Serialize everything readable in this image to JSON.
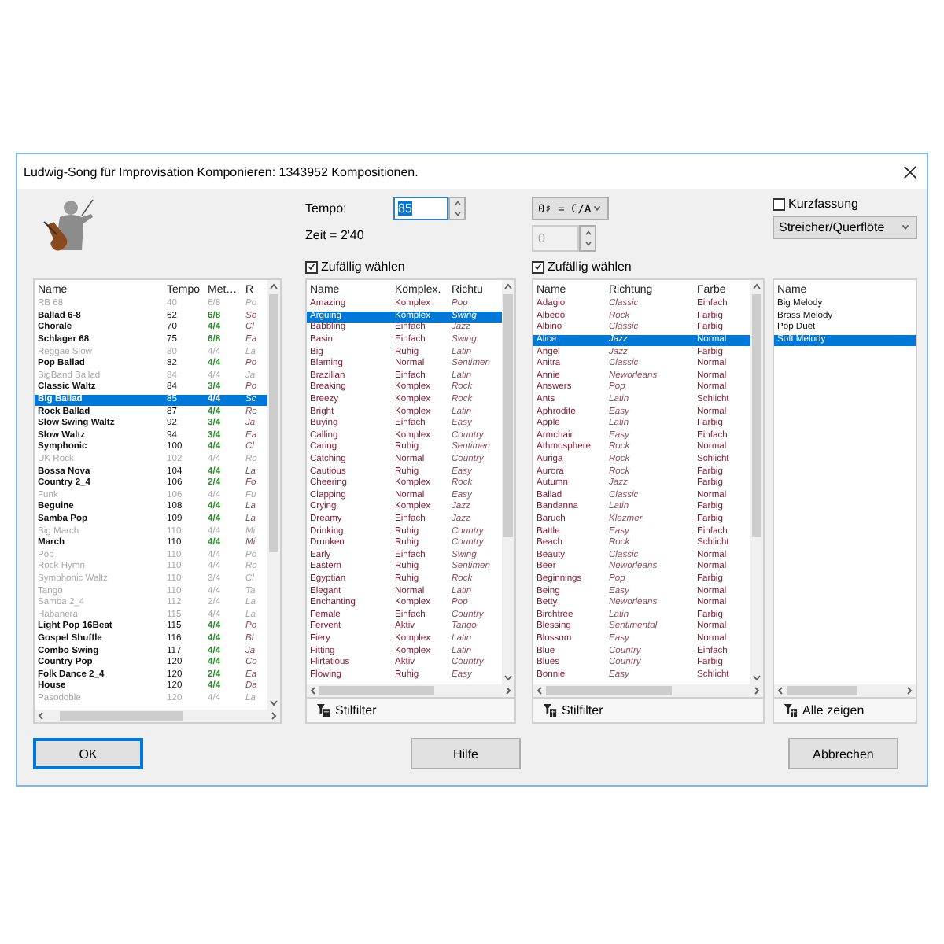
{
  "window": {
    "title": "Ludwig-Song für Improvisation Komponieren: 1343952 Kompositionen."
  },
  "tempo": {
    "label": "Tempo:",
    "value": "85",
    "selected": true,
    "duration": "Zeit = 2'40"
  },
  "key": {
    "value": "0♯ = C/A",
    "transpose": "0",
    "transpose_disabled": true
  },
  "summary": {
    "label": "Kurzfassung",
    "checked": false
  },
  "instrumentation": {
    "value": "Streicher/Querflöte"
  },
  "styles": {
    "columns": [
      {
        "label": "Name",
        "kind": "bold"
      },
      {
        "label": "Tempo",
        "kind": "plain"
      },
      {
        "label": "Met…",
        "kind": "meter"
      },
      {
        "label": "R",
        "kind": "italic"
      }
    ],
    "rows": [
      {
        "cells": [
          "RB 68",
          "40",
          "6/8",
          "Po"
        ],
        "greyed": true,
        "selected": false
      },
      {
        "cells": [
          "Ballad 6-8",
          "62",
          "6/8",
          "Se"
        ],
        "greyed": false,
        "selected": false
      },
      {
        "cells": [
          "Chorale",
          "70",
          "4/4",
          "Cl"
        ],
        "greyed": false,
        "selected": false
      },
      {
        "cells": [
          "Schlager 68",
          "75",
          "6/8",
          "Ea"
        ],
        "greyed": false,
        "selected": false
      },
      {
        "cells": [
          "Reggae Slow",
          "80",
          "4/4",
          "La"
        ],
        "greyed": true,
        "selected": false
      },
      {
        "cells": [
          "Pop Ballad",
          "82",
          "4/4",
          "Po"
        ],
        "greyed": false,
        "selected": false
      },
      {
        "cells": [
          "BigBand Ballad",
          "84",
          "4/4",
          "Ja"
        ],
        "greyed": true,
        "selected": false
      },
      {
        "cells": [
          "Classic Waltz",
          "84",
          "3/4",
          "Po"
        ],
        "greyed": false,
        "selected": false
      },
      {
        "cells": [
          "Big Ballad",
          "85",
          "4/4",
          "Sc"
        ],
        "greyed": false,
        "selected": true
      },
      {
        "cells": [
          "Rock Ballad",
          "87",
          "4/4",
          "Ro"
        ],
        "greyed": false,
        "selected": false
      },
      {
        "cells": [
          "Slow Swing Waltz",
          "92",
          "3/4",
          "Ja"
        ],
        "greyed": false,
        "selected": false
      },
      {
        "cells": [
          "Slow Waltz",
          "94",
          "3/4",
          "Ea"
        ],
        "greyed": false,
        "selected": false
      },
      {
        "cells": [
          "Symphonic",
          "100",
          "4/4",
          "Cl"
        ],
        "greyed": false,
        "selected": false
      },
      {
        "cells": [
          "UK Rock",
          "102",
          "4/4",
          "Ro"
        ],
        "greyed": true,
        "selected": false
      },
      {
        "cells": [
          "Bossa Nova",
          "104",
          "4/4",
          "La"
        ],
        "greyed": false,
        "selected": false
      },
      {
        "cells": [
          "Country 2_4",
          "106",
          "2/4",
          "Fo"
        ],
        "greyed": false,
        "selected": false
      },
      {
        "cells": [
          "Funk",
          "106",
          "4/4",
          "Fu"
        ],
        "greyed": true,
        "selected": false
      },
      {
        "cells": [
          "Beguine",
          "108",
          "4/4",
          "La"
        ],
        "greyed": false,
        "selected": false
      },
      {
        "cells": [
          "Samba Pop",
          "109",
          "4/4",
          "La"
        ],
        "greyed": false,
        "selected": false
      },
      {
        "cells": [
          "Big March",
          "110",
          "4/4",
          "Mi"
        ],
        "greyed": true,
        "selected": false
      },
      {
        "cells": [
          "March",
          "110",
          "4/4",
          "Mi"
        ],
        "greyed": false,
        "selected": false
      },
      {
        "cells": [
          "Pop",
          "110",
          "4/4",
          "Po"
        ],
        "greyed": true,
        "selected": false
      },
      {
        "cells": [
          "Rock Hymn",
          "110",
          "4/4",
          "Ro"
        ],
        "greyed": true,
        "selected": false
      },
      {
        "cells": [
          "Symphonic Waltz",
          "110",
          "3/4",
          "Cl"
        ],
        "greyed": true,
        "selected": false
      },
      {
        "cells": [
          "Tango",
          "110",
          "4/4",
          "Ta"
        ],
        "greyed": true,
        "selected": false
      },
      {
        "cells": [
          "Samba 2_4",
          "112",
          "2/4",
          "La"
        ],
        "greyed": true,
        "selected": false
      },
      {
        "cells": [
          "Habanera",
          "115",
          "4/4",
          "La"
        ],
        "greyed": true,
        "selected": false
      },
      {
        "cells": [
          "Light Pop 16Beat",
          "115",
          "4/4",
          "Po"
        ],
        "greyed": false,
        "selected": false
      },
      {
        "cells": [
          "Gospel Shuffle",
          "116",
          "4/4",
          "Bl"
        ],
        "greyed": false,
        "selected": false
      },
      {
        "cells": [
          "Combo Swing",
          "117",
          "4/4",
          "Ja"
        ],
        "greyed": false,
        "selected": false
      },
      {
        "cells": [
          "Country Pop",
          "120",
          "4/4",
          "Co"
        ],
        "greyed": false,
        "selected": false
      },
      {
        "cells": [
          "Folk Dance 2_4",
          "120",
          "2/4",
          "Ea"
        ],
        "greyed": false,
        "selected": false
      },
      {
        "cells": [
          "House",
          "120",
          "4/4",
          "Da"
        ],
        "greyed": false,
        "selected": false
      },
      {
        "cells": [
          "Pasodoble",
          "120",
          "4/4",
          "La"
        ],
        "greyed": true,
        "selected": false
      }
    ]
  },
  "melodies": {
    "random_pick": {
      "label": "Zufällig wählen",
      "checked": true
    },
    "filter_button": "Stilfilter",
    "columns": [
      {
        "label": "Name",
        "kind": "red"
      },
      {
        "label": "Komplex.",
        "kind": "red"
      },
      {
        "label": "Richtu",
        "kind": "italic"
      }
    ],
    "rows": [
      {
        "cells": [
          "Amazing",
          "Komplex",
          "Pop"
        ],
        "selected": false
      },
      {
        "cells": [
          "Arguing",
          "Komplex",
          "Swing"
        ],
        "selected": true
      },
      {
        "cells": [
          "Babbling",
          "Einfach",
          "Jazz"
        ],
        "selected": false
      },
      {
        "cells": [
          "Basin",
          "Einfach",
          "Swing"
        ],
        "selected": false
      },
      {
        "cells": [
          "Big",
          "Ruhig",
          "Latin"
        ],
        "selected": false
      },
      {
        "cells": [
          "Blaming",
          "Normal",
          "Sentimen"
        ],
        "selected": false
      },
      {
        "cells": [
          "Brazilian",
          "Einfach",
          "Latin"
        ],
        "selected": false
      },
      {
        "cells": [
          "Breaking",
          "Komplex",
          "Rock"
        ],
        "selected": false
      },
      {
        "cells": [
          "Breezy",
          "Komplex",
          "Rock"
        ],
        "selected": false
      },
      {
        "cells": [
          "Bright",
          "Komplex",
          "Latin"
        ],
        "selected": false
      },
      {
        "cells": [
          "Buying",
          "Einfach",
          "Easy"
        ],
        "selected": false
      },
      {
        "cells": [
          "Calling",
          "Komplex",
          "Country"
        ],
        "selected": false
      },
      {
        "cells": [
          "Caring",
          "Ruhig",
          "Sentimen"
        ],
        "selected": false
      },
      {
        "cells": [
          "Catching",
          "Normal",
          "Country"
        ],
        "selected": false
      },
      {
        "cells": [
          "Cautious",
          "Ruhig",
          "Easy"
        ],
        "selected": false
      },
      {
        "cells": [
          "Cheering",
          "Komplex",
          "Rock"
        ],
        "selected": false
      },
      {
        "cells": [
          "Clapping",
          "Normal",
          "Easy"
        ],
        "selected": false
      },
      {
        "cells": [
          "Crying",
          "Komplex",
          "Jazz"
        ],
        "selected": false
      },
      {
        "cells": [
          "Dreamy",
          "Einfach",
          "Jazz"
        ],
        "selected": false
      },
      {
        "cells": [
          "Drinking",
          "Ruhig",
          "Country"
        ],
        "selected": false
      },
      {
        "cells": [
          "Drunken",
          "Ruhig",
          "Country"
        ],
        "selected": false
      },
      {
        "cells": [
          "Early",
          "Einfach",
          "Swing"
        ],
        "selected": false
      },
      {
        "cells": [
          "Eastern",
          "Ruhig",
          "Sentimen"
        ],
        "selected": false
      },
      {
        "cells": [
          "Egyptian",
          "Ruhig",
          "Rock"
        ],
        "selected": false
      },
      {
        "cells": [
          "Elegant",
          "Normal",
          "Latin"
        ],
        "selected": false
      },
      {
        "cells": [
          "Enchanting",
          "Komplex",
          "Pop"
        ],
        "selected": false
      },
      {
        "cells": [
          "Female",
          "Einfach",
          "Country"
        ],
        "selected": false
      },
      {
        "cells": [
          "Fervent",
          "Aktiv",
          "Tango"
        ],
        "selected": false
      },
      {
        "cells": [
          "Fiery",
          "Komplex",
          "Latin"
        ],
        "selected": false
      },
      {
        "cells": [
          "Fitting",
          "Komplex",
          "Latin"
        ],
        "selected": false
      },
      {
        "cells": [
          "Flirtatious",
          "Aktiv",
          "Country"
        ],
        "selected": false
      },
      {
        "cells": [
          "Flowing",
          "Ruhig",
          "Easy"
        ],
        "selected": false
      }
    ]
  },
  "harmonies": {
    "random_pick": {
      "label": "Zufällig wählen",
      "checked": true
    },
    "filter_button": "Stilfilter",
    "columns": [
      {
        "label": "Name",
        "kind": "red"
      },
      {
        "label": "Richtung",
        "kind": "italic"
      },
      {
        "label": "Farbe",
        "kind": "red"
      }
    ],
    "rows": [
      {
        "cells": [
          "Adagio",
          "Classic",
          "Einfach"
        ],
        "selected": false
      },
      {
        "cells": [
          "Albedo",
          "Rock",
          "Farbig"
        ],
        "selected": false
      },
      {
        "cells": [
          "Albino",
          "Classic",
          "Farbig"
        ],
        "selected": false
      },
      {
        "cells": [
          "Alice",
          "Jazz",
          "Normal"
        ],
        "selected": true
      },
      {
        "cells": [
          "Angel",
          "Jazz",
          "Farbig"
        ],
        "selected": false
      },
      {
        "cells": [
          "Anitra",
          "Classic",
          "Normal"
        ],
        "selected": false
      },
      {
        "cells": [
          "Annie",
          "Neworleans",
          "Normal"
        ],
        "selected": false
      },
      {
        "cells": [
          "Answers",
          "Pop",
          "Normal"
        ],
        "selected": false
      },
      {
        "cells": [
          "Ants",
          "Latin",
          "Schlicht"
        ],
        "selected": false
      },
      {
        "cells": [
          "Aphrodite",
          "Easy",
          "Normal"
        ],
        "selected": false
      },
      {
        "cells": [
          "Apple",
          "Latin",
          "Farbig"
        ],
        "selected": false
      },
      {
        "cells": [
          "Armchair",
          "Easy",
          "Einfach"
        ],
        "selected": false
      },
      {
        "cells": [
          "Athmosphere",
          "Rock",
          "Normal"
        ],
        "selected": false
      },
      {
        "cells": [
          "Auriga",
          "Rock",
          "Schlicht"
        ],
        "selected": false
      },
      {
        "cells": [
          "Aurora",
          "Rock",
          "Farbig"
        ],
        "selected": false
      },
      {
        "cells": [
          "Autumn",
          "Jazz",
          "Farbig"
        ],
        "selected": false
      },
      {
        "cells": [
          "Ballad",
          "Classic",
          "Normal"
        ],
        "selected": false
      },
      {
        "cells": [
          "Bandanna",
          "Latin",
          "Farbig"
        ],
        "selected": false
      },
      {
        "cells": [
          "Baruch",
          "Klezmer",
          "Farbig"
        ],
        "selected": false
      },
      {
        "cells": [
          "Battle",
          "Easy",
          "Einfach"
        ],
        "selected": false
      },
      {
        "cells": [
          "Beach",
          "Rock",
          "Schlicht"
        ],
        "selected": false
      },
      {
        "cells": [
          "Beauty",
          "Classic",
          "Normal"
        ],
        "selected": false
      },
      {
        "cells": [
          "Beer",
          "Neworleans",
          "Normal"
        ],
        "selected": false
      },
      {
        "cells": [
          "Beginnings",
          "Pop",
          "Farbig"
        ],
        "selected": false
      },
      {
        "cells": [
          "Being",
          "Easy",
          "Normal"
        ],
        "selected": false
      },
      {
        "cells": [
          "Betty",
          "Neworleans",
          "Normal"
        ],
        "selected": false
      },
      {
        "cells": [
          "Birchtree",
          "Latin",
          "Farbig"
        ],
        "selected": false
      },
      {
        "cells": [
          "Blessing",
          "Sentimental",
          "Normal"
        ],
        "selected": false
      },
      {
        "cells": [
          "Blossom",
          "Easy",
          "Normal"
        ],
        "selected": false
      },
      {
        "cells": [
          "Blue",
          "Country",
          "Einfach"
        ],
        "selected": false
      },
      {
        "cells": [
          "Blues",
          "Country",
          "Farbig"
        ],
        "selected": false
      },
      {
        "cells": [
          "Bonnie",
          "Easy",
          "Schlicht"
        ],
        "selected": false
      }
    ]
  },
  "voices": {
    "columns": [
      {
        "label": "Name",
        "kind": "plain"
      }
    ],
    "show_all_button": "Alle zeigen",
    "rows": [
      {
        "cells": [
          "Big Melody"
        ],
        "selected": false
      },
      {
        "cells": [
          "Brass Melody"
        ],
        "selected": false
      },
      {
        "cells": [
          "Pop Duet"
        ],
        "selected": false
      },
      {
        "cells": [
          "Soft Melody"
        ],
        "selected": true
      }
    ]
  },
  "buttons": [
    {
      "label": "OK",
      "focused": true
    },
    {
      "label": "Hilfe",
      "focused": false
    },
    {
      "label": "Abbrechen",
      "focused": false
    }
  ]
}
